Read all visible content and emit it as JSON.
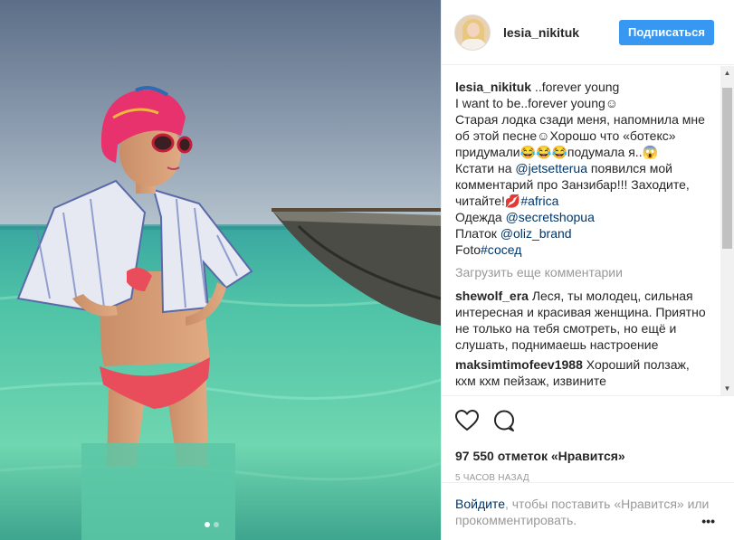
{
  "post": {
    "username": "lesia_nikituk",
    "follow_label": "Подписаться",
    "caption_suffix": " ..forever young",
    "caption_lines": [
      "I want to be..forever young☺",
      "Старая лодка сзади меня, напомнила мне",
      "об этой песне☺Хорошо что «ботекс»",
      "придумали😂😂😂подумала я..😱"
    ],
    "mention1_prefix": "Кстати на ",
    "mention1": "@jetsetterua",
    "mention1_suffix": " появился мой",
    "mention1_line2": "комментарий про Занзибар!!! Заходите,",
    "mention1_line3": "читайте!💋",
    "hashtag_africa": "#africa",
    "clothes_label": "Одежда ",
    "clothes_link": "@secretshopua",
    "scarf_label": "Платок ",
    "scarf_link": "@oliz_brand",
    "photo_label": "Foto",
    "photo_tag": "#сосед",
    "load_more": "Загрузить еще комментарии",
    "comments": [
      {
        "user": "shewolf_era",
        "text": " Леся, ты молодец, сильная интересная и красивая женщина. Приятно не только на тебя смотреть, но ещё и слушать, поднимаешь настроение"
      },
      {
        "user": "maksimtimofeev1988",
        "text": " Хороший ползаж, кхм кхм пейзаж, извините"
      }
    ],
    "likes": "97 550 отметок «Нравится»",
    "time": "5 часов назад",
    "login_link": "Войдите",
    "login_rest": ", чтобы поставить «Нравится» или прокомментировать.",
    "more_icon": "ellipsis-icon",
    "icons": [
      "heart-icon",
      "comment-icon"
    ]
  },
  "carousel": {
    "count": 2,
    "active": 1
  }
}
